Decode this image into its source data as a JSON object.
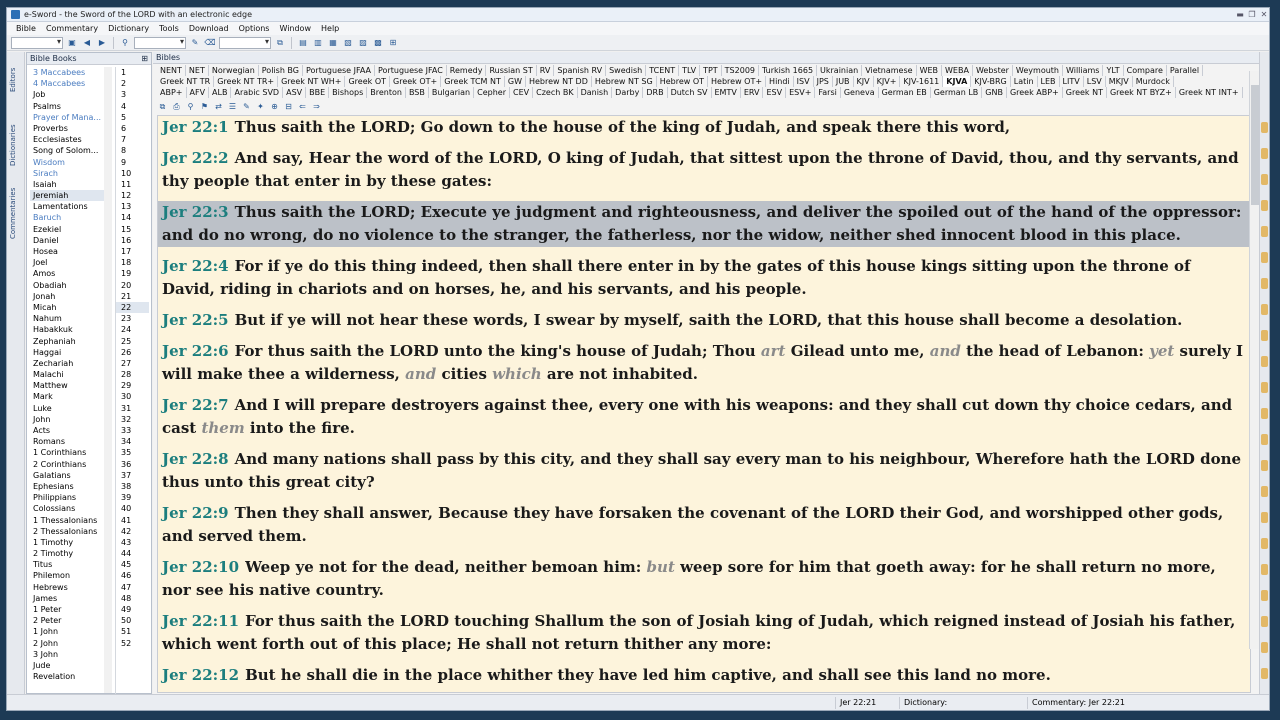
{
  "window": {
    "title": "e-Sword - the Sword of the LORD with an electronic edge"
  },
  "menu": [
    "Bible",
    "Commentary",
    "Dictionary",
    "Tools",
    "Download",
    "Options",
    "Window",
    "Help"
  ],
  "sidetabs": [
    "Editors",
    "Dictionaries",
    "Commentaries"
  ],
  "books_panel": {
    "title": "Bible Books",
    "books": [
      {
        "name": "3 Maccabees",
        "apoc": true
      },
      {
        "name": "4 Maccabees",
        "apoc": true
      },
      {
        "name": "Job",
        "apoc": false
      },
      {
        "name": "Psalms",
        "apoc": false
      },
      {
        "name": "Prayer of Mana...",
        "apoc": true
      },
      {
        "name": "Proverbs",
        "apoc": false
      },
      {
        "name": "Ecclesiastes",
        "apoc": false
      },
      {
        "name": "Song of Solom...",
        "apoc": false
      },
      {
        "name": "Wisdom",
        "apoc": true
      },
      {
        "name": "Sirach",
        "apoc": true
      },
      {
        "name": "Isaiah",
        "apoc": false
      },
      {
        "name": "Jeremiah",
        "apoc": false,
        "selected": true
      },
      {
        "name": "Lamentations",
        "apoc": false
      },
      {
        "name": "Baruch",
        "apoc": true
      },
      {
        "name": "Ezekiel",
        "apoc": false
      },
      {
        "name": "Daniel",
        "apoc": false
      },
      {
        "name": "Hosea",
        "apoc": false
      },
      {
        "name": "Joel",
        "apoc": false
      },
      {
        "name": "Amos",
        "apoc": false
      },
      {
        "name": "Obadiah",
        "apoc": false
      },
      {
        "name": "Jonah",
        "apoc": false
      },
      {
        "name": "Micah",
        "apoc": false
      },
      {
        "name": "Nahum",
        "apoc": false
      },
      {
        "name": "Habakkuk",
        "apoc": false
      },
      {
        "name": "Zephaniah",
        "apoc": false
      },
      {
        "name": "Haggai",
        "apoc": false
      },
      {
        "name": "Zechariah",
        "apoc": false
      },
      {
        "name": "Malachi",
        "apoc": false
      },
      {
        "name": "Matthew",
        "apoc": false
      },
      {
        "name": "Mark",
        "apoc": false
      },
      {
        "name": "Luke",
        "apoc": false
      },
      {
        "name": "John",
        "apoc": false
      },
      {
        "name": "Acts",
        "apoc": false
      },
      {
        "name": "Romans",
        "apoc": false
      },
      {
        "name": "1 Corinthians",
        "apoc": false
      },
      {
        "name": "2 Corinthians",
        "apoc": false
      },
      {
        "name": "Galatians",
        "apoc": false
      },
      {
        "name": "Ephesians",
        "apoc": false
      },
      {
        "name": "Philippians",
        "apoc": false
      },
      {
        "name": "Colossians",
        "apoc": false
      },
      {
        "name": "1 Thessalonians",
        "apoc": false
      },
      {
        "name": "2 Thessalonians",
        "apoc": false
      },
      {
        "name": "1 Timothy",
        "apoc": false
      },
      {
        "name": "2 Timothy",
        "apoc": false
      },
      {
        "name": "Titus",
        "apoc": false
      },
      {
        "name": "Philemon",
        "apoc": false
      },
      {
        "name": "Hebrews",
        "apoc": false
      },
      {
        "name": "James",
        "apoc": false
      },
      {
        "name": "1 Peter",
        "apoc": false
      },
      {
        "name": "2 Peter",
        "apoc": false
      },
      {
        "name": "1 John",
        "apoc": false
      },
      {
        "name": "2 John",
        "apoc": false
      },
      {
        "name": "3 John",
        "apoc": false
      },
      {
        "name": "Jude",
        "apoc": false
      },
      {
        "name": "Revelation",
        "apoc": false
      }
    ],
    "chapter_count": 52,
    "selected_chapter": 22
  },
  "bibles_panel": {
    "title": "Bibles",
    "tab_rows": [
      [
        "NENT",
        "NET",
        "Norwegian",
        "Polish BG",
        "Portuguese JFAA",
        "Portuguese JFAC",
        "Remedy",
        "Russian ST",
        "RV",
        "Spanish RV",
        "Swedish",
        "TCENT",
        "TLV",
        "TPT",
        "TS2009",
        "Turkish 1665",
        "Ukrainian",
        "Vietnamese",
        "WEB",
        "WEBA",
        "Webster",
        "Weymouth",
        "Williams",
        "YLT",
        "Compare",
        "Parallel"
      ],
      [
        "Greek NT TR",
        "Greek NT TR+",
        "Greek NT WH+",
        "Greek OT",
        "Greek OT+",
        "Greek TCM NT",
        "GW",
        "Hebrew NT DD",
        "Hebrew NT SG",
        "Hebrew OT",
        "Hebrew OT+",
        "Hindi",
        "ISV",
        "JPS",
        "JUB",
        "KJV",
        "KJV+",
        "KJV-1611",
        "KJVA",
        "KJV-BRG",
        "Latin",
        "LEB",
        "LITV",
        "LSV",
        "MKJV",
        "Murdock"
      ],
      [
        "ABP+",
        "AFV",
        "ALB",
        "Arabic SVD",
        "ASV",
        "BBE",
        "Bishops",
        "Brenton",
        "BSB",
        "Bulgarian",
        "Cepher",
        "CEV",
        "Czech BK",
        "Danish",
        "Darby",
        "DRB",
        "Dutch SV",
        "EMTV",
        "ERV",
        "ESV",
        "ESV+",
        "Farsi",
        "Geneva",
        "German EB",
        "German LB",
        "GNB",
        "Greek ABP+",
        "Greek NT",
        "Greek NT BYZ+",
        "Greek NT INT+"
      ]
    ],
    "active_tab": "KJVA",
    "verses": [
      {
        "ref": "Jer 22:1",
        "parts": [
          {
            "t": "Thus saith the LORD; Go down to the house of the king of Judah, and speak there this word,"
          }
        ]
      },
      {
        "ref": "Jer 22:2",
        "parts": [
          {
            "t": "And say, Hear the word of the LORD, O king of Judah, that sittest upon the throne of David, thou, and thy servants, and thy people that enter in by these gates:"
          }
        ]
      },
      {
        "ref": "Jer 22:3",
        "selected": true,
        "parts": [
          {
            "t": "Thus saith the LORD; Execute ye judgment and righteousness, and deliver the spoiled out of the hand of the oppressor: and do no wrong, do no violence to the stranger, the fatherless, nor the widow, neither shed innocent blood in this place."
          }
        ]
      },
      {
        "ref": "Jer 22:4",
        "parts": [
          {
            "t": "For if ye do this thing indeed, then shall there enter in by the gates of this house kings sitting upon the throne of David, riding in chariots and on horses, he, and his servants, and his people."
          }
        ]
      },
      {
        "ref": "Jer 22:5",
        "parts": [
          {
            "t": "But if ye will not hear these words, I swear by myself, saith the LORD, that this house shall become a desolation."
          }
        ]
      },
      {
        "ref": "Jer 22:6",
        "parts": [
          {
            "t": "For thus saith the LORD unto the king's house of Judah; Thou "
          },
          {
            "t": "art",
            "i": true
          },
          {
            "t": " Gilead unto me, "
          },
          {
            "t": "and",
            "i": true
          },
          {
            "t": " the head of Lebanon: "
          },
          {
            "t": "yet",
            "i": true
          },
          {
            "t": " surely I will make thee a wilderness, "
          },
          {
            "t": "and",
            "i": true
          },
          {
            "t": " cities "
          },
          {
            "t": "which",
            "i": true
          },
          {
            "t": " are not inhabited."
          }
        ]
      },
      {
        "ref": "Jer 22:7",
        "parts": [
          {
            "t": "And I will prepare destroyers against thee, every one with his weapons: and they shall cut down thy choice cedars, and cast "
          },
          {
            "t": "them",
            "i": true
          },
          {
            "t": " into the fire."
          }
        ]
      },
      {
        "ref": "Jer 22:8",
        "parts": [
          {
            "t": "And many nations shall pass by this city, and they shall say every man to his neighbour, Wherefore hath the LORD done thus unto this great city?"
          }
        ]
      },
      {
        "ref": "Jer 22:9",
        "parts": [
          {
            "t": "Then they shall answer, Because they have forsaken the covenant of the LORD their God, and worshipped other gods, and served them."
          }
        ]
      },
      {
        "ref": "Jer 22:10",
        "parts": [
          {
            "t": "Weep ye not for the dead, neither bemoan him: "
          },
          {
            "t": "but",
            "i": true
          },
          {
            "t": " weep sore for him that goeth away: for he shall return no more, nor see his native country."
          }
        ]
      },
      {
        "ref": "Jer 22:11",
        "parts": [
          {
            "t": "For thus saith the LORD touching Shallum the son of Josiah king of Judah, which reigned instead of Josiah his father, which went forth out of this place; He shall not return thither any more:"
          }
        ]
      },
      {
        "ref": "Jer 22:12",
        "parts": [
          {
            "t": "But he shall die in the place whither they have led him captive, and shall see this land no more."
          }
        ]
      }
    ]
  },
  "status": {
    "verse": "Jer 22:21",
    "dictionary": "Dictionary:",
    "commentary": "Commentary: Jer 22:21"
  }
}
